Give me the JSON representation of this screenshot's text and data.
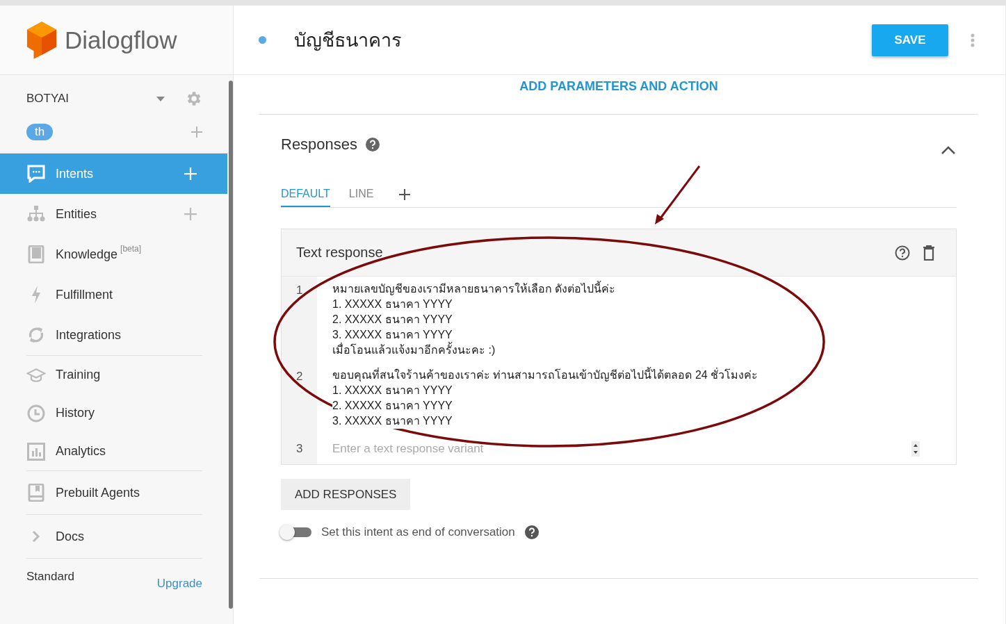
{
  "sidebar": {
    "logo": "Dialogflow",
    "agent": "BOTYAI",
    "language": "th",
    "sections": [
      [
        {
          "label": "Intents",
          "selected": true,
          "add": true
        },
        {
          "label": "Entities",
          "selected": false,
          "add": true
        },
        {
          "label": "Knowledge",
          "badge": "[beta]",
          "selected": false,
          "add": false
        },
        {
          "label": "Fulfillment",
          "selected": false,
          "add": false
        },
        {
          "label": "Integrations",
          "selected": false,
          "add": false
        }
      ],
      [
        {
          "label": "Training",
          "selected": false,
          "add": false
        },
        {
          "label": "History",
          "selected": false,
          "add": false
        },
        {
          "label": "Analytics",
          "selected": false,
          "add": false
        }
      ],
      [
        {
          "label": "Prebuilt Agents",
          "selected": false,
          "add": false
        }
      ],
      [
        {
          "label": "Docs",
          "selected": false,
          "add": false
        }
      ]
    ],
    "plan": "Standard",
    "upgrade": "Upgrade"
  },
  "header": {
    "title": "บัญชีธนาคาร",
    "save": "SAVE"
  },
  "add_parameters": "ADD PARAMETERS AND ACTION",
  "responses": {
    "title": "Responses",
    "expanded": true,
    "tabs": [
      {
        "label": "DEFAULT",
        "selected": true
      },
      {
        "label": "LINE",
        "selected": false
      }
    ],
    "card_title": "Text response",
    "variants": [
      {
        "number": "1",
        "lines": [
          "หมายเลขบัญชีของเรามีหลายธนาคารให้เลือก ดังต่อไปนี้ค่ะ",
          "1. XXXXX ธนาคา YYYY",
          "2. XXXXX ธนาคา YYYY",
          "3. XXXXX ธนาคา YYYY",
          "เมื่อโอนแล้วแจ้งมาอีกครั้งนะคะ :)"
        ]
      },
      {
        "number": "2",
        "lines": [
          "ขอบคุณที่สนใจร้านค้าของเราค่ะ ท่านสามารถโอนเข้าบัญชีต่อไปนี้ได้ตลอด 24 ชั่วโมงค่ะ",
          "1. XXXXX ธนาคา YYYY",
          "2. XXXXX ธนาคา YYYY",
          "3. XXXXX ธนาคา YYYY"
        ]
      }
    ],
    "new_number": "3",
    "placeholder": "Enter a text response variant",
    "add_responses": "ADD RESPONSES",
    "end_conversation": {
      "label": "Set this intent as end of conversation",
      "on": false
    }
  }
}
